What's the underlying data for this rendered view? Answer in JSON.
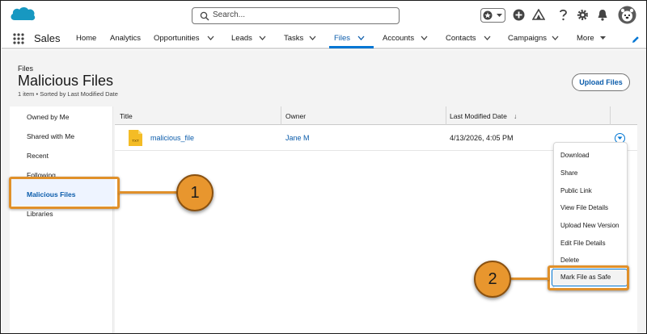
{
  "search": {
    "placeholder": "Search..."
  },
  "app": {
    "name": "Sales"
  },
  "nav": [
    {
      "label": "Home"
    },
    {
      "label": "Analytics"
    },
    {
      "label": "Opportunities"
    },
    {
      "label": "Leads"
    },
    {
      "label": "Tasks"
    },
    {
      "label": "Files"
    },
    {
      "label": "Accounts"
    },
    {
      "label": "Contacts"
    },
    {
      "label": "Campaigns"
    },
    {
      "label": "More"
    }
  ],
  "page": {
    "breadcrumb": "Files",
    "title": "Malicious Files",
    "meta": "1 item • Sorted by Last Modified Date",
    "upload_label": "Upload Files"
  },
  "sidebar": {
    "items": [
      {
        "label": "Owned by Me"
      },
      {
        "label": "Shared with Me"
      },
      {
        "label": "Recent"
      },
      {
        "label": "Following"
      },
      {
        "label": "Malicious Files"
      },
      {
        "label": "Libraries"
      }
    ]
  },
  "table": {
    "columns": [
      "Title",
      "Owner",
      "Last Modified Date"
    ],
    "sort_indicator": "↓",
    "rows": [
      {
        "file_type": "TXT",
        "title": "malicious_file",
        "owner": "Jane M",
        "modified": "4/13/2026, 4:05 PM"
      }
    ]
  },
  "menu": {
    "items": [
      {
        "label": "Download"
      },
      {
        "label": "Share"
      },
      {
        "label": "Public Link"
      },
      {
        "label": "View File Details"
      },
      {
        "label": "Upload New Version"
      },
      {
        "label": "Edit File Details"
      },
      {
        "label": "Delete"
      },
      {
        "label": "Mark File as Safe"
      }
    ]
  },
  "callouts": [
    {
      "number": "1"
    },
    {
      "number": "2"
    }
  ],
  "colors": {
    "brand_blue": "#0176d3",
    "link_blue": "#0b5cab",
    "callout_orange": "#e0902a",
    "file_icon_yellow": "#f4bc25"
  },
  "icons": [
    "salesforce-cloud-icon",
    "search-icon",
    "star-icon",
    "chevron-down-icon",
    "plus-icon",
    "trailhead-icon",
    "help-icon",
    "gear-icon",
    "bell-icon",
    "avatar-icon",
    "app-launcher-icon",
    "edit-pen-icon",
    "txt-file-icon"
  ]
}
